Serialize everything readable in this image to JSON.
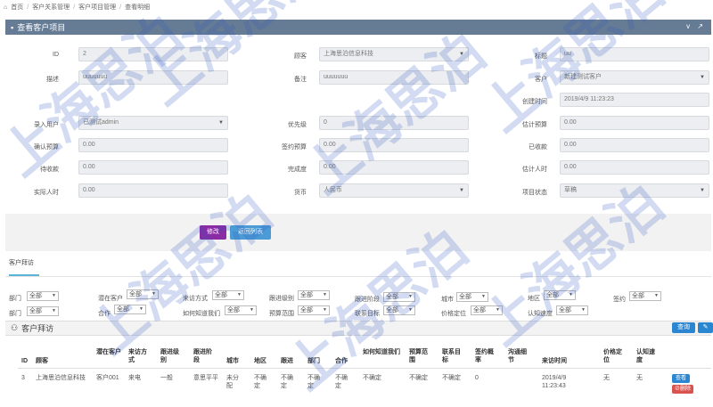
{
  "breadcrumb": [
    "首页",
    "客户关系管理",
    "客户项目管理",
    "查看明细"
  ],
  "panel_title": "查看客户项目",
  "panel_tools": "v ↗",
  "fields": {
    "id": {
      "label": "ID",
      "value": "2"
    },
    "customer": {
      "label": "顾客",
      "value": "上海思泊信息科技"
    },
    "title": {
      "label": "标题",
      "value": "uu"
    },
    "desc": {
      "label": "描述",
      "value": "uuuuuuu"
    },
    "remark": {
      "label": "备注",
      "value": "uuuuuuu"
    },
    "client": {
      "label": "客户",
      "value": "新建测试客户"
    },
    "created": {
      "label": "创建时间",
      "value": "2019/4/9 11:23:23"
    },
    "entry_user": {
      "label": "录入用户",
      "value": "已测试admin"
    },
    "priority": {
      "label": "优先级",
      "value": "0"
    },
    "est_budget": {
      "label": "估计预算",
      "value": "0.00"
    },
    "confirm_budget": {
      "label": "确认预算",
      "value": "0.00"
    },
    "signed_budget": {
      "label": "签约预算",
      "value": "0.00"
    },
    "received": {
      "label": "已收款",
      "value": "0.00"
    },
    "pending": {
      "label": "待收款",
      "value": "0.00"
    },
    "completion": {
      "label": "完成度",
      "value": "0.00"
    },
    "est_person": {
      "label": "估计人时",
      "value": "0.00"
    },
    "actual_person": {
      "label": "实际人时",
      "value": "0.00"
    },
    "currency": {
      "label": "货币",
      "value": "人民币"
    },
    "status": {
      "label": "项目状态",
      "value": "草稿"
    }
  },
  "buttons": {
    "edit": "修改",
    "back": "返回列表",
    "query": "查询"
  },
  "tab": "客户拜访",
  "filters": {
    "dept_a": "部门",
    "dept_b": "部门",
    "potential": "潜在客户",
    "cooperate": "合作",
    "visit_method": "来访方式",
    "how_know": "如何知道我们",
    "follow": "跟进级别",
    "budget": "预算范围",
    "follow_stage": "跟进阶段",
    "contact_target": "联系目标",
    "city": "城市",
    "price_pos": "价格定位",
    "region": "地区",
    "know_speed": "认知速度",
    "sign": "签约",
    "all": "全部"
  },
  "visit_title": "客户拜访",
  "visit_table": {
    "headers": [
      "ID",
      "顾客",
      "潜在客户",
      "来访方式",
      "跟进级别",
      "跟进阶段",
      "城市",
      "地区",
      "跟进",
      "部门",
      "合作",
      "如何知道我们",
      "预算范围",
      "联系目标",
      "签约概率",
      "沟通细节",
      "来访时间",
      "价格定位",
      "认知速度"
    ],
    "row": [
      "3",
      "上海思泊信息科技",
      "客户001",
      "来电",
      "一般",
      "意思平平",
      "未分配",
      "不确定",
      "不确定",
      "不确定",
      "不确定",
      "不确定",
      "不确定",
      "不确定",
      "0",
      "",
      "2019/4/9 11:23:43",
      "无",
      "无"
    ],
    "row_actions": [
      "查看",
      "删除"
    ]
  },
  "watermark": "上海思泊"
}
